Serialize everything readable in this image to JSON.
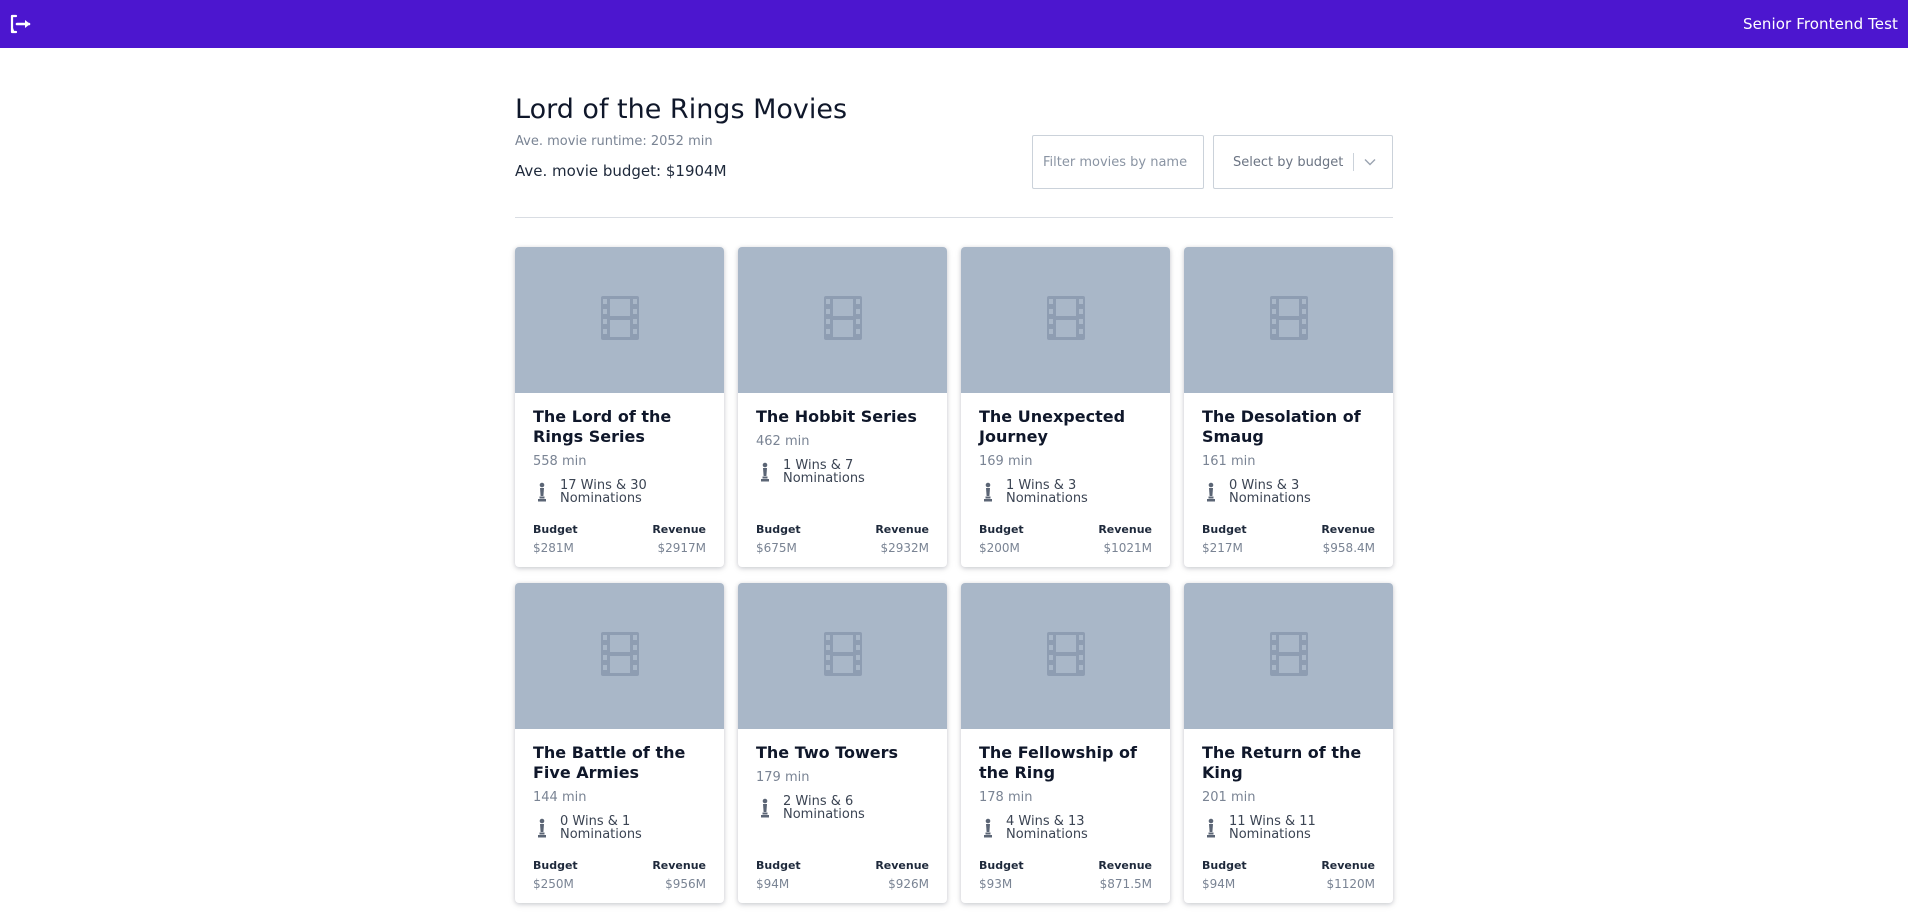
{
  "app": {
    "title": "Senior Frontend Test",
    "logo_icon": "exit-arrow-logo-icon",
    "brand_color": "#4c16cf"
  },
  "header": {
    "title": "Lord of the Rings Movies",
    "avg_runtime": "Ave. movie runtime: 2052 min",
    "avg_budget": "Ave. movie budget: $1904M"
  },
  "filters": {
    "name_placeholder": "Filter movies by name",
    "name_value": "",
    "budget_select_label": "Select by budget",
    "budget_icon": "chevron-down-icon"
  },
  "labels": {
    "budget": "Budget",
    "revenue": "Revenue"
  },
  "movies": [
    {
      "title": "The Lord of the Rings Series",
      "runtime": "558 min",
      "awards": "17 Wins & 30 Nominations",
      "budget": "$281M",
      "revenue": "$2917M"
    },
    {
      "title": "The Hobbit Series",
      "runtime": "462 min",
      "awards": "1 Wins & 7 Nominations",
      "budget": "$675M",
      "revenue": "$2932M"
    },
    {
      "title": "The Unexpected Journey",
      "runtime": "169 min",
      "awards": "1 Wins & 3 Nominations",
      "budget": "$200M",
      "revenue": "$1021M"
    },
    {
      "title": "The Desolation of Smaug",
      "runtime": "161 min",
      "awards": "0 Wins & 3 Nominations",
      "budget": "$217M",
      "revenue": "$958.4M"
    },
    {
      "title": "The Battle of the Five Armies",
      "runtime": "144 min",
      "awards": "0 Wins & 1 Nominations",
      "budget": "$250M",
      "revenue": "$956M"
    },
    {
      "title": "The Two Towers",
      "runtime": "179 min",
      "awards": "2 Wins & 6 Nominations",
      "budget": "$94M",
      "revenue": "$926M"
    },
    {
      "title": "The Fellowship of the Ring",
      "runtime": "178 min",
      "awards": "4 Wins & 13 Nominations",
      "budget": "$93M",
      "revenue": "$871.5M"
    },
    {
      "title": "The Return of the King",
      "runtime": "201 min",
      "awards": "11 Wins & 11 Nominations",
      "budget": "$94M",
      "revenue": "$1120M"
    }
  ]
}
